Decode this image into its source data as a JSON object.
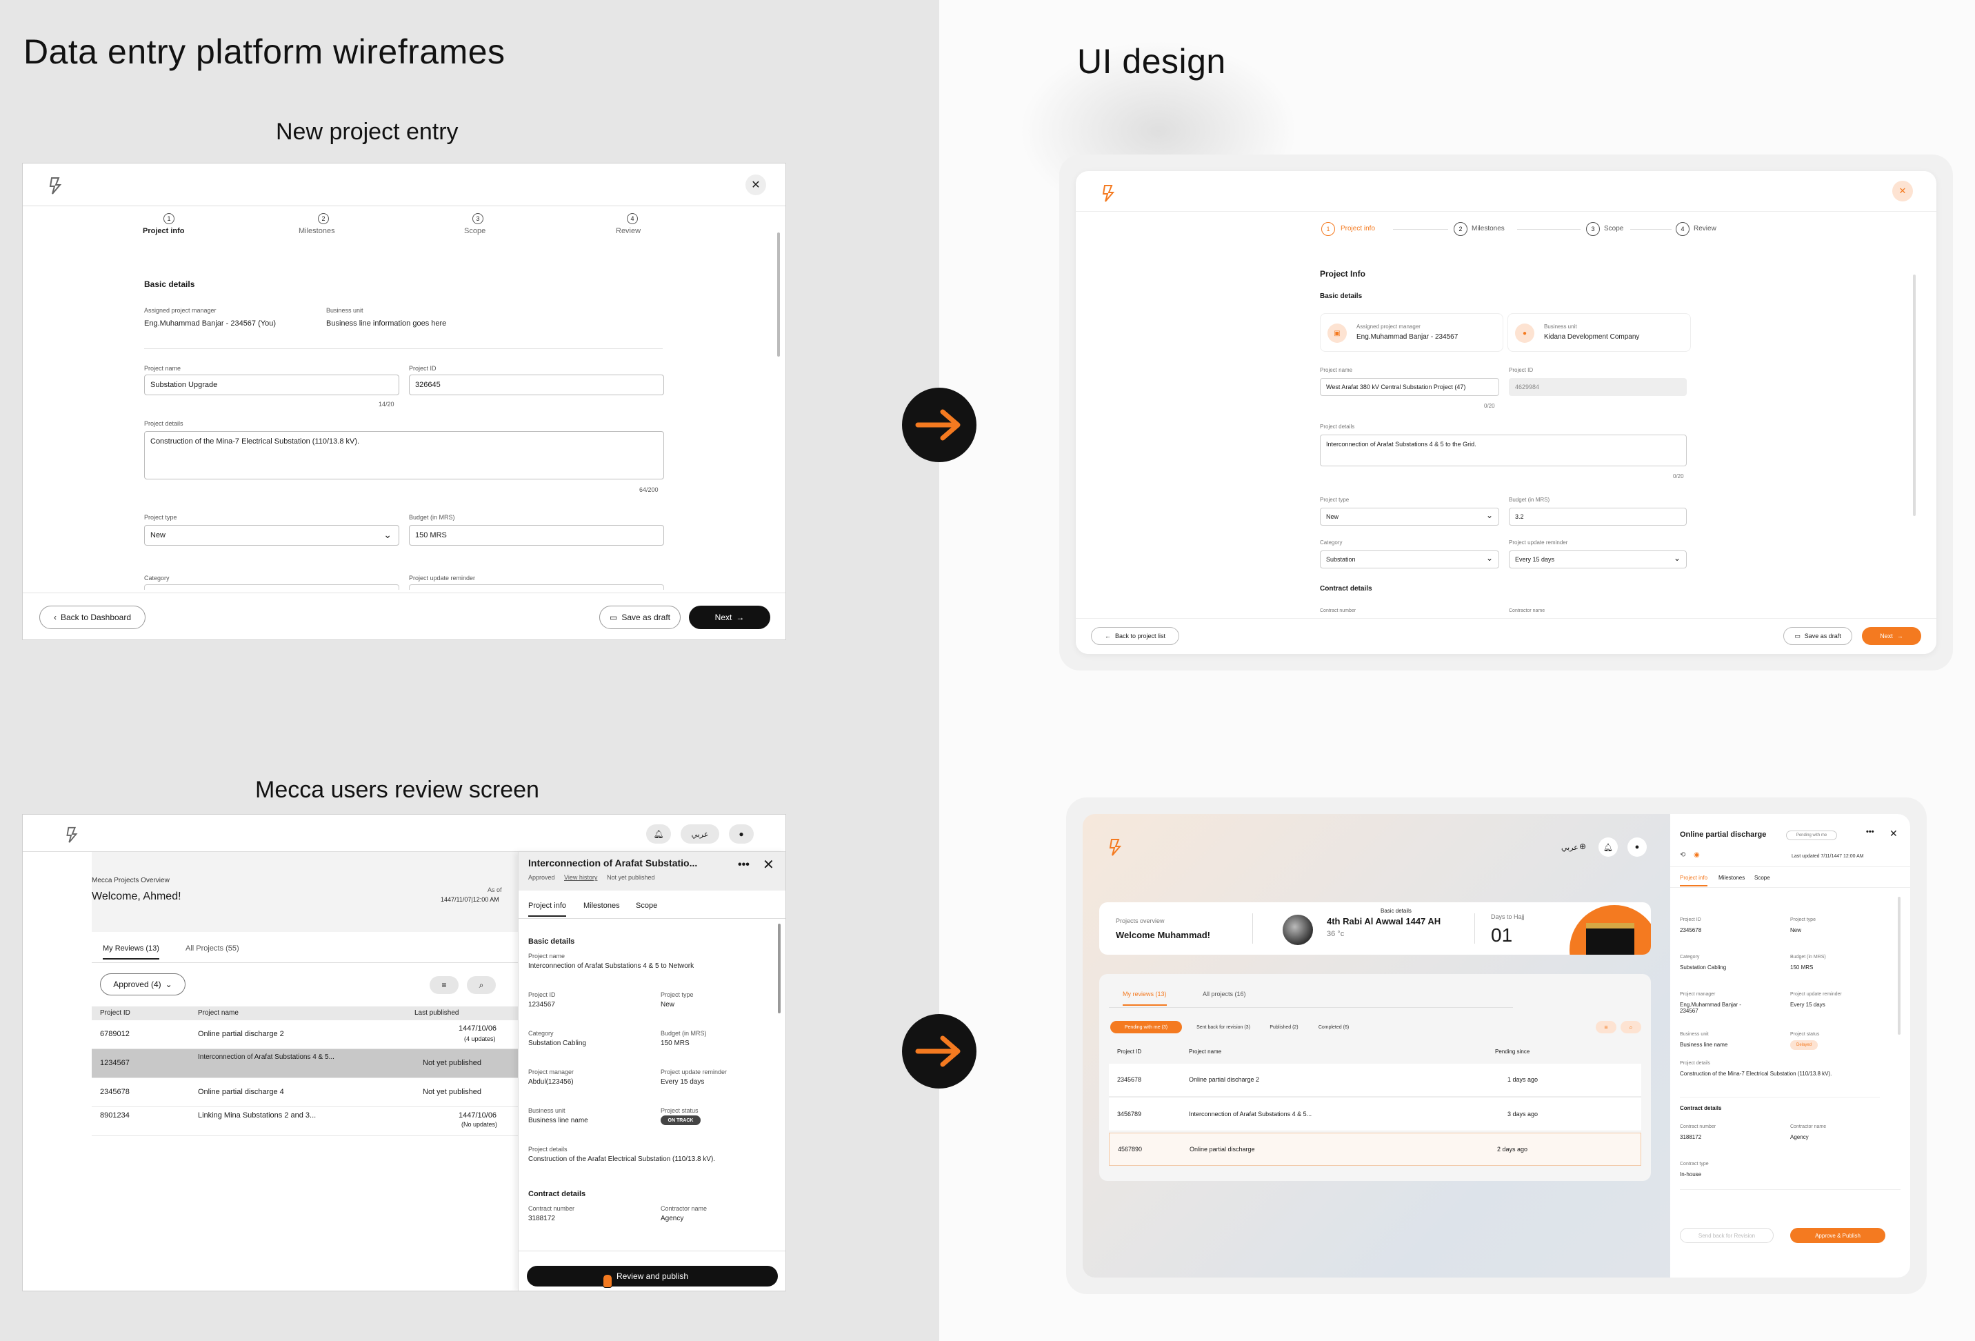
{
  "page": {
    "left_title": "Data entry platform wireframes",
    "right_title": "UI design",
    "section1_title": "New project entry",
    "section2_title": "Mecca users review screen"
  },
  "colors": {
    "accent": "#f47a20",
    "dark": "#121212",
    "left_bg": "#e6e6e6"
  },
  "wf1": {
    "steps": [
      {
        "num": "1",
        "label": "Project info"
      },
      {
        "num": "2",
        "label": "Milestones"
      },
      {
        "num": "3",
        "label": "Scope"
      },
      {
        "num": "4",
        "label": "Review"
      }
    ],
    "section": "Basic details",
    "pm_label": "Assigned project manager",
    "pm_value": "Eng.Muhammad Banjar - 234567 (You)",
    "bu_label": "Business unit",
    "bu_value": "Business line information goes here",
    "name_label": "Project name",
    "name_value": "Substation Upgrade",
    "name_count": "14/20",
    "id_label": "Project ID",
    "id_value": "326645",
    "details_label": "Project details",
    "details_value": "Construction of the Mina-7 Electrical Substation (110/13.8 kV).",
    "details_count": "64/200",
    "type_label": "Project type",
    "type_value": "New",
    "budget_label": "Budget (in MRS)",
    "budget_value": "150 MRS",
    "category_label": "Category",
    "reminder_label": "Project update reminder",
    "back_btn": "Back to Dashboard",
    "draft_btn": "Save as draft",
    "next_btn": "Next"
  },
  "ui1": {
    "steps": [
      {
        "num": "1",
        "label": "Project info"
      },
      {
        "num": "2",
        "label": "Milestones"
      },
      {
        "num": "3",
        "label": "Scope"
      },
      {
        "num": "4",
        "label": "Review"
      }
    ],
    "heading": "Project Info",
    "section": "Basic details",
    "pm_label": "Assigned project manager",
    "pm_value": "Eng.Muhammad Banjar - 234567",
    "bu_label": "Business unit",
    "bu_value": "Kidana Development Company",
    "name_label": "Project name",
    "name_value": "West Arafat 380 kV Central Substation Project (47)",
    "name_count": "0/20",
    "id_label": "Project ID",
    "id_value": "4629984",
    "details_label": "Project details",
    "details_value": "Interconnection of Arafat Substations 4 & 5 to the Grid.",
    "details_count": "0/20",
    "type_label": "Project type",
    "type_value": "New",
    "budget_label": "Budget (in MRS)",
    "budget_value": "3.2",
    "category_label": "Category",
    "category_value": "Substation",
    "reminder_label": "Project update reminder",
    "reminder_value": "Every 15 days",
    "contract_section": "Contract details",
    "contract_number_label": "Contract number",
    "contractor_name_label": "Contractor name",
    "back_btn": "Back to project list",
    "draft_btn": "Save as draft",
    "next_btn": "Next"
  },
  "wf2": {
    "lang": "عربي",
    "overview": "Mecca Projects Overview",
    "welcome": "Welcome, Ahmed!",
    "as_of": "As of",
    "as_of_date": "1447/11/07|12:00 AM",
    "tabs": [
      "My Reviews (13)",
      "All Projects (55)"
    ],
    "filter": "Approved (4)",
    "columns": [
      "Project ID",
      "Project name",
      "Last published"
    ],
    "rows": [
      {
        "id": "6789012",
        "name": "Online partial discharge 2",
        "published": "1447/10/06",
        "note": "(4 updates)"
      },
      {
        "id": "1234567",
        "name": "Interconnection of Arafat Substations 4 & 5...",
        "published": "Not yet published",
        "note": ""
      },
      {
        "id": "2345678",
        "name": "Online partial discharge 4",
        "published": "Not yet published",
        "note": ""
      },
      {
        "id": "8901234",
        "name": "Linking Mina Substations 2 and 3...",
        "published": "1447/10/06",
        "note": "(No updates)"
      }
    ],
    "panel": {
      "title": "Interconnection of Arafat Substatio...",
      "status": "Approved",
      "history": "View history",
      "pub": "Not yet published",
      "tabs": [
        "Project info",
        "Milestones",
        "Scope"
      ],
      "section": "Basic details",
      "name_label": "Project name",
      "name_value": "Interconnection of Arafat Substations 4 & 5 to Network",
      "id_label": "Project ID",
      "id_value": "1234567",
      "type_label": "Project type",
      "type_value": "New",
      "cat_label": "Category",
      "cat_value": "Substation Cabling",
      "budget_label": "Budget (in MRS)",
      "budget_value": "150 MRS",
      "pm_label": "Project manager",
      "pm_value": "Abdul(123456)",
      "rem_label": "Project update reminder",
      "rem_value": "Every 15 days",
      "bu_label": "Business unit",
      "bu_value": "Business line name",
      "st_label": "Project status",
      "st_value": "ON TRACK",
      "det_label": "Project details",
      "det_value": "Construction of the Arafat Electrical Substation (110/13.8 kV).",
      "contract_section": "Contract details",
      "cn_label": "Contract number",
      "cn_value": "3188172",
      "ctr_label": "Contractor name",
      "ctr_value": "Agency",
      "action": "Review and publish"
    }
  },
  "ui2": {
    "lang": "عربي",
    "overview": "Projects overview",
    "welcome": "Welcome Muhammad!",
    "date_label": "Basic details",
    "date_value": "4th Rabi Al Awwal 1447 AH",
    "temp": "36 °c",
    "hajj_label": "Days to Hajj",
    "hajj_value": "01",
    "tabs": [
      "My reviews (13)",
      "All projects (16)"
    ],
    "filters": [
      "Pending with me (3)",
      "Sent back for revision (3)",
      "Published (2)",
      "Completed (6)"
    ],
    "columns": [
      "Project ID",
      "Project name",
      "Pending since"
    ],
    "rows": [
      {
        "id": "2345678",
        "name": "Online partial discharge 2",
        "since": "1 days ago"
      },
      {
        "id": "3456789",
        "name": "Interconnection of Arafat Substations 4 & 5...",
        "since": "3 days ago"
      },
      {
        "id": "4567890",
        "name": "Online partial discharge",
        "since": "2 days ago"
      }
    ],
    "panel": {
      "title": "Online partial discharge",
      "badge": "Pending with me",
      "updated": "Last updated 7/11/1447 12:00 AM",
      "tabs": [
        "Project info",
        "Milestones",
        "Scope"
      ],
      "id_label": "Project ID",
      "id_value": "2345678",
      "type_label": "Project type",
      "type_value": "New",
      "cat_label": "Category",
      "cat_value": "Substation Cabling",
      "budget_label": "Budget (in MRS)",
      "budget_value": "150 MRS",
      "pm_label": "Project manager",
      "pm_value": "Eng.Muhammad Banjar - 234567",
      "rem_label": "Project update reminder",
      "rem_value": "Every 15 days",
      "bu_label": "Business unit",
      "bu_value": "Business line name",
      "st_label": "Project status",
      "st_value": "Delayed",
      "det_label": "Project details",
      "det_value": "Construction of the Mina-7 Electrical Substation (110/13.8 kV).",
      "contract_section": "Contract details",
      "cn_label": "Contract number",
      "cn_value": "3188172",
      "ctr_label": "Contractor name",
      "ctr_value": "Agency",
      "ct_label": "Contract type",
      "ct_value": "In-house",
      "send_back": "Send back for Revision",
      "approve": "Approve & Publish"
    }
  }
}
